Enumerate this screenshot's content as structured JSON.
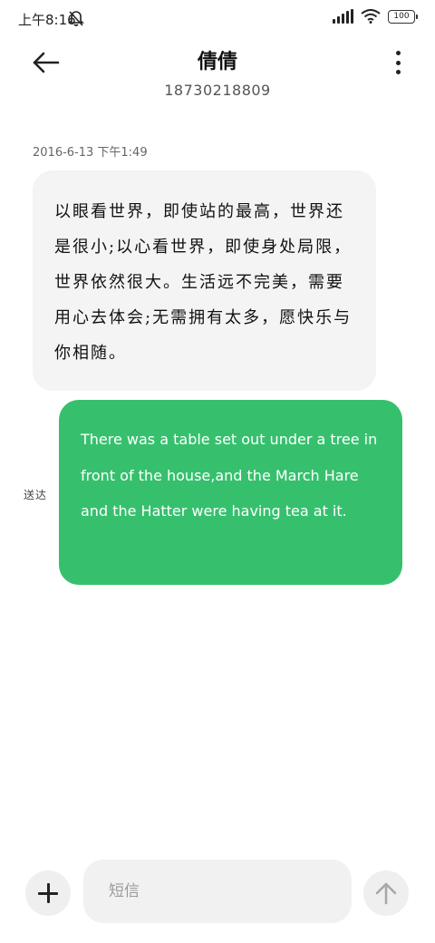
{
  "status_bar": {
    "time": "上午8:16",
    "battery": "100"
  },
  "header": {
    "contact_name": "倩倩",
    "phone_number": "18730218809"
  },
  "messages": [
    {
      "direction": "incoming",
      "timestamp": "2016-6-13 下午1:49",
      "text": "以眼看世界，即使站的最高，世界还是很小;以心看世界，即使身处局限，世界依然很大。生活远不完美，需要用心去体会;无需拥有太多，愿快乐与你相随。"
    },
    {
      "direction": "outgoing",
      "text": "There was a table set out under a tree in front of the house,and the March Hare and the Hatter were having tea at it.",
      "status": "送达"
    }
  ],
  "input_bar": {
    "placeholder": "短信"
  },
  "colors": {
    "outgoing_bubble": "#36c06e",
    "incoming_bubble": "#f4f4f4"
  }
}
